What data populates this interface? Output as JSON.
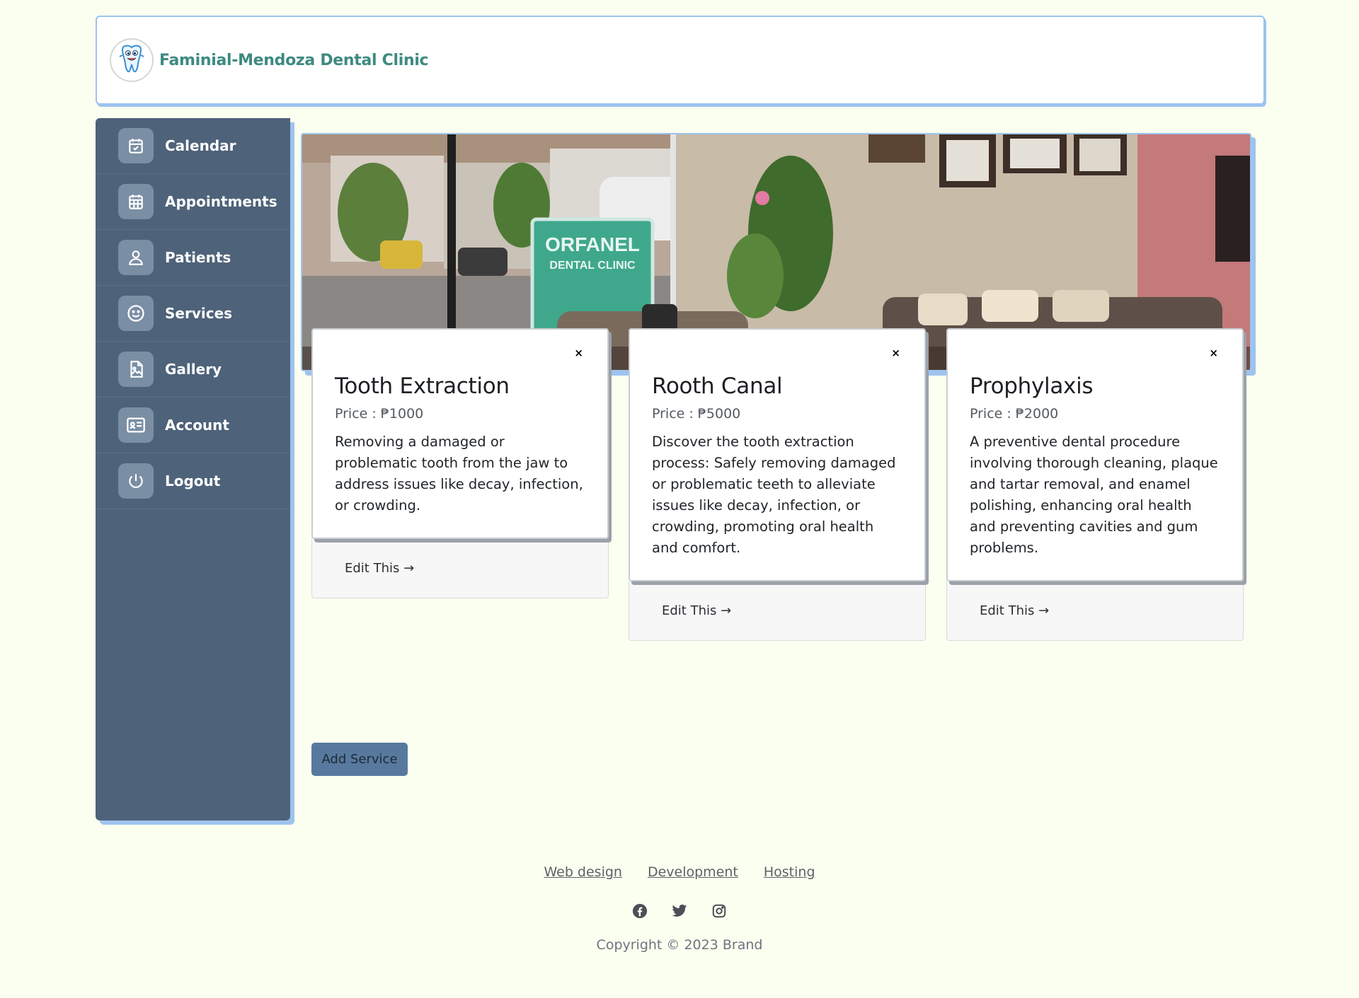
{
  "header": {
    "clinic_name": "Faminial-Mendoza Dental Clinic",
    "logo_icon": "tooth-mascot-icon"
  },
  "sidebar": {
    "items": [
      {
        "label": "Calendar",
        "icon": "calendar-check-icon"
      },
      {
        "label": "Appointments",
        "icon": "calendar-grid-icon"
      },
      {
        "label": "Patients",
        "icon": "person-icon"
      },
      {
        "label": "Services",
        "icon": "smiley-icon"
      },
      {
        "label": "Gallery",
        "icon": "image-file-icon"
      },
      {
        "label": "Account",
        "icon": "id-card-icon"
      },
      {
        "label": "Logout",
        "icon": "power-icon"
      }
    ]
  },
  "banner": {
    "sign_line1": "ORFANEL",
    "sign_line2": "DENTAL CLINIC"
  },
  "services": [
    {
      "title": "Tooth Extraction",
      "price": "Price : ₱1000",
      "description": "Removing a damaged or problematic tooth from the jaw to address issues like decay, infection, or crowding.",
      "close": "×",
      "edit": "Edit This →"
    },
    {
      "title": "Rooth Canal",
      "price": "Price : ₱5000",
      "description": "Discover the tooth extraction process: Safely removing damaged or problematic teeth to alleviate issues like decay, infection, or crowding, promoting oral health and comfort.",
      "close": "×",
      "edit": "Edit This →"
    },
    {
      "title": "Prophylaxis",
      "price": "Price : ₱2000",
      "description": "A preventive dental procedure involving thorough cleaning, plaque and tartar removal, and enamel polishing, enhancing oral health and preventing cavities and gum problems.",
      "close": "×",
      "edit": "Edit This →"
    }
  ],
  "add_service_label": "Add Service",
  "footer": {
    "links": [
      "Web design",
      "Development",
      "Hosting"
    ],
    "socials": [
      "facebook-icon",
      "twitter-icon",
      "instagram-icon"
    ],
    "copyright": "Copyright © 2023 Brand"
  },
  "colors": {
    "background": "#fbfff0",
    "sidebar": "#4e6279",
    "accent_border": "#9dc3ef",
    "brand_text": "#3d8a80",
    "button": "#58799e"
  }
}
